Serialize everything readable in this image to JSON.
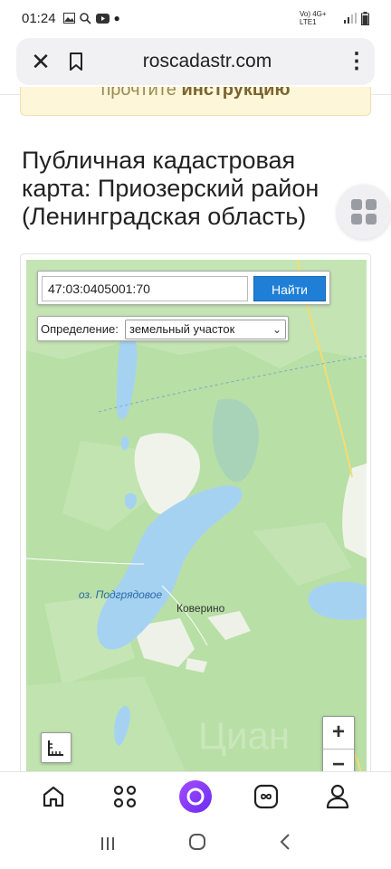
{
  "status": {
    "time": "01:24",
    "net": "Vo) 4G+ LTE1"
  },
  "browser": {
    "url": "roscadastr.com",
    "close_icon": "close-icon",
    "bookmark_icon": "bookmark-icon",
    "menu_icon": "more-vert-icon"
  },
  "notice": {
    "prefix": "прочтите ",
    "link": "инструкцию"
  },
  "page": {
    "title": "Публичная кадастровая карта: Приозерский район (Ленинградская область)"
  },
  "map": {
    "search_value": "47:03:0405001:70",
    "find_label": "Найти",
    "definition_label": "Определение:",
    "definition_value": "земельный участок",
    "lake_label": "оз. Подгрядовое",
    "village_label": "Коверино",
    "zoom_in": "+",
    "zoom_out": "−",
    "colors": {
      "forest": "#b8dfa6",
      "water": "#a6d2f2",
      "open": "#f0f3ea",
      "road": "#f5dc72"
    }
  },
  "bottom_nav": [
    "home-icon",
    "services-grid-icon",
    "alice-assistant-icon",
    "tabs-infinity-icon",
    "profile-icon"
  ],
  "system_nav": [
    "recents-icon",
    "home-circle-icon",
    "back-chevron-icon"
  ]
}
